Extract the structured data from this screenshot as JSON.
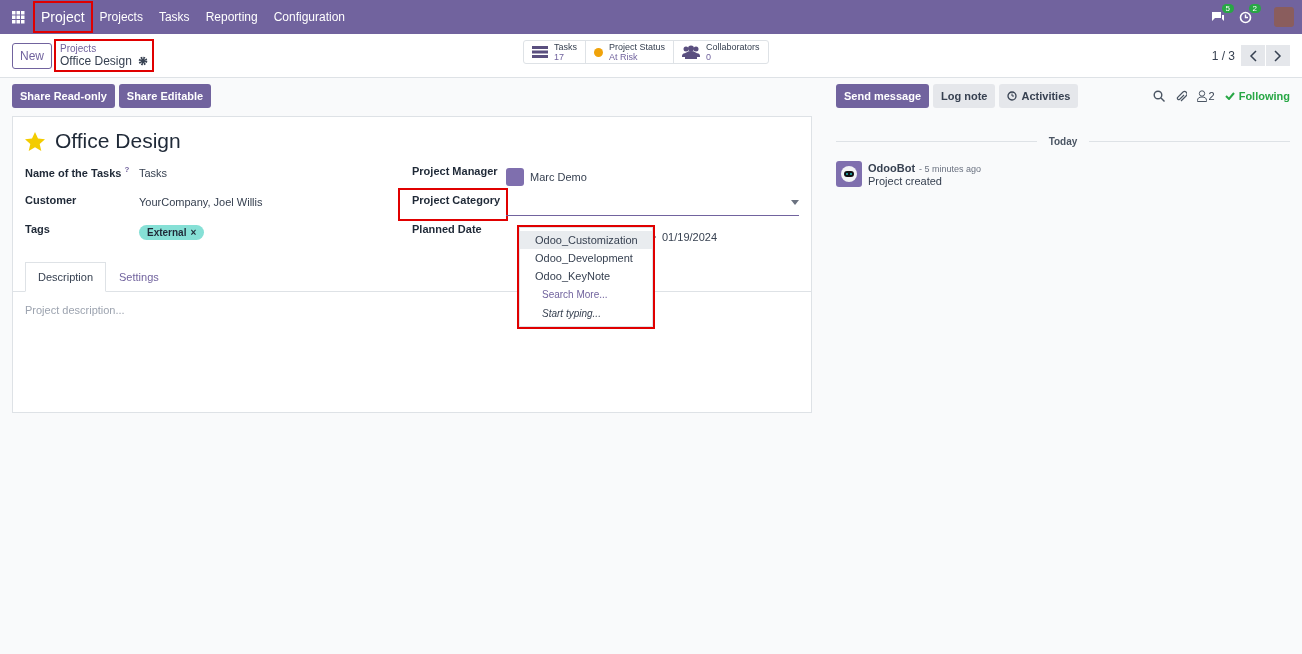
{
  "navbar": {
    "app_name": "Project",
    "app_highlighted": true,
    "menu": [
      "Projects",
      "Tasks",
      "Reporting",
      "Configuration"
    ],
    "message_count": "5",
    "activity_count": "2"
  },
  "control_panel": {
    "new_button": "New",
    "breadcrumb_parent": "Projects",
    "breadcrumb_current": "Office Design",
    "breadcrumb_highlighted": true,
    "stats": [
      {
        "kind": "tasks",
        "label": "Tasks",
        "value": "17"
      },
      {
        "kind": "status",
        "label": "Project Status",
        "value": "At Risk",
        "color": "#f0a30a"
      },
      {
        "kind": "collaborators",
        "label": "Collaborators",
        "value": "0"
      }
    ],
    "pager": "1 / 3"
  },
  "actions": [
    "Share Read-only",
    "Share Editable"
  ],
  "form": {
    "title": "Office Design",
    "favorite": true,
    "left_fields": [
      {
        "label": "Name of the Tasks",
        "help": "?",
        "value": "Tasks"
      },
      {
        "label": "Customer",
        "value": "YourCompany, Joel Willis"
      },
      {
        "label": "Tags",
        "tag": "External",
        "tag_remove": "×"
      }
    ],
    "project_manager": {
      "label": "Project Manager",
      "value": "Marc Demo"
    },
    "project_category": {
      "label": "Project Category",
      "highlighted": true
    },
    "planned_date": {
      "label": "Planned Date",
      "end": "01/19/2024"
    },
    "dropdown": {
      "highlighted": true,
      "options": [
        {
          "label": "Odoo_Customization",
          "selected": true
        },
        {
          "label": "Odoo_Development",
          "selected": false
        },
        {
          "label": "Odoo_KeyNote",
          "selected": false
        }
      ],
      "search_more": "Search More...",
      "hint": "Start typing..."
    },
    "tabs": [
      {
        "label": "Description",
        "selected": true
      },
      {
        "label": "Settings",
        "selected": false
      }
    ],
    "description_placeholder": "Project description..."
  },
  "chatter": {
    "buttons": [
      {
        "label": "Send message",
        "selected": true
      },
      {
        "label": "Log note",
        "selected": false
      },
      {
        "label": "Activities",
        "selected": false
      }
    ],
    "followers": "2",
    "following": "Following",
    "date_separator": "Today",
    "messages": [
      {
        "author": "OdooBot",
        "time": "- 5 minutes ago",
        "body": "Project created"
      }
    ]
  }
}
